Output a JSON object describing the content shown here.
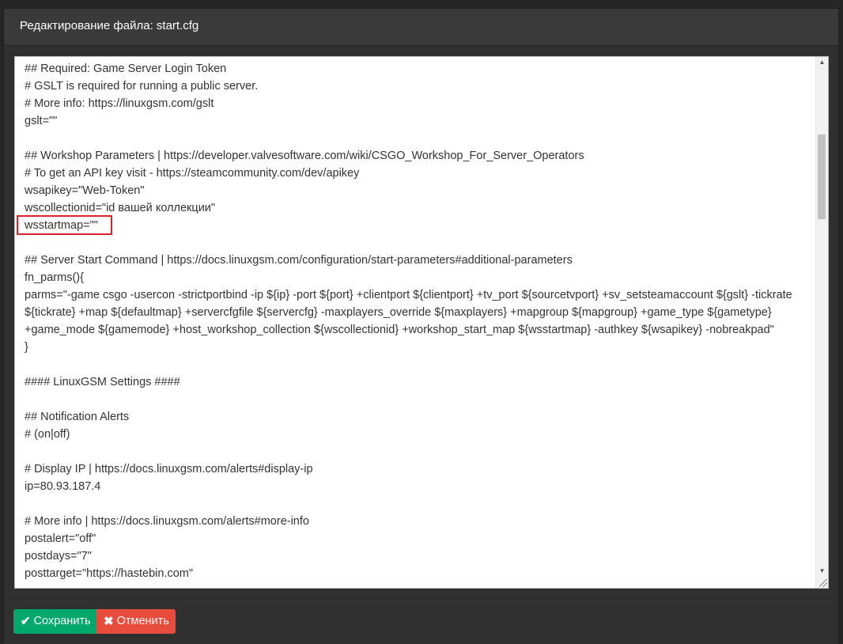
{
  "modal": {
    "title": "Редактирование файла: start.cfg"
  },
  "editor": {
    "lines": [
      "## Required: Game Server Login Token",
      "# GSLT is required for running a public server.",
      "# More info: https://linuxgsm.com/gslt",
      "gslt=\"\"",
      "",
      "## Workshop Parameters | https://developer.valvesoftware.com/wiki/CSGO_Workshop_For_Server_Operators",
      "# To get an API key visit - https://steamcommunity.com/dev/apikey",
      "wsapikey=\"Web-Token\"",
      "wscollectionid=\"id вашей коллекции\"",
      "wsstartmap=\"\"",
      "",
      "## Server Start Command | https://docs.linuxgsm.com/configuration/start-parameters#additional-parameters",
      "fn_parms(){",
      "parms=\"-game csgo -usercon -strictportbind -ip ${ip} -port ${port} +clientport ${clientport} +tv_port ${sourcetvport} +sv_setsteamaccount ${gslt} -tickrate ${tickrate} +map ${defaultmap} +servercfgfile ${servercfg} -maxplayers_override ${maxplayers} +mapgroup ${mapgroup} +game_type ${gametype} +game_mode ${gamemode} +host_workshop_collection ${wscollectionid} +workshop_start_map ${wsstartmap} -authkey ${wsapikey} -nobreakpad\"",
      "}",
      "",
      "#### LinuxGSM Settings ####",
      "",
      "## Notification Alerts",
      "# (on|off)",
      "",
      "# Display IP | https://docs.linuxgsm.com/alerts#display-ip",
      "ip=80.93.187.4",
      "",
      "# More info | https://docs.linuxgsm.com/alerts#more-info",
      "postalert=\"off\"",
      "postdays=\"7\"",
      "posttarget=\"https://hastebin.com\""
    ],
    "highlighted_line_index": 9,
    "highlight_color": "#e0202a"
  },
  "footer": {
    "save_label": "Сохранить",
    "cancel_label": "Отменить",
    "save_color": "#00a86b",
    "cancel_color": "#e74c3c",
    "save_icon": "check-icon",
    "cancel_icon": "close-icon"
  }
}
